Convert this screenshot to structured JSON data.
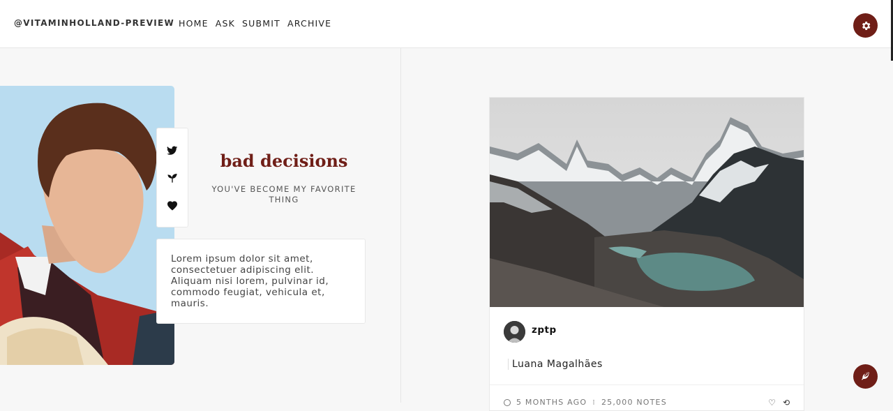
{
  "header": {
    "site_name": "@VITAMINHOLLAND-PREVIEW",
    "nav": [
      {
        "label": "HOME"
      },
      {
        "label": "ASK"
      },
      {
        "label": "SUBMIT"
      },
      {
        "label": "ARCHIVE"
      }
    ],
    "settings_icon": "gear-icon"
  },
  "sidebar": {
    "social_icons": [
      "twitter-icon",
      "sprout-icon",
      "heart-icon"
    ],
    "blog_title": "bad decisions",
    "blog_subtitle": "YOU'VE BECOME MY FAVORITE THING",
    "description": "Lorem ipsum dolor sit amet, consectetuer adipiscing elit. Aliquam nisi lorem, pulvinar id, commodo feugiat, vehicula et, mauris."
  },
  "post": {
    "username": "zptp",
    "caption": "Luana Magalhães",
    "time_ago": "5 MONTHS AGO",
    "notes": "25,000 NOTES"
  },
  "colors": {
    "accent": "#6f1e17"
  },
  "fab_icon": "feather-icon"
}
